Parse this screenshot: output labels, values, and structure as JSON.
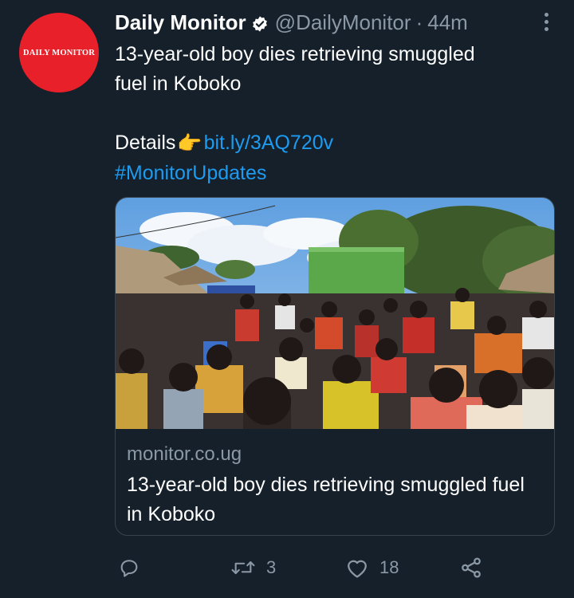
{
  "tweet": {
    "avatar_text": "DAILY MONITOR",
    "display_name": "Daily Monitor",
    "handle": "@DailyMonitor",
    "separator": "·",
    "time": "44m",
    "text_line1": "13-year-old boy dies retrieving smuggled",
    "text_line2": "fuel in Koboko",
    "details_label": "Details",
    "pointer_emoji": "👉",
    "link": "bit.ly/3AQ720v",
    "hashtag": "#MonitorUpdates"
  },
  "card": {
    "domain": "monitor.co.ug",
    "title": "13-year-old boy dies retrieving smuggled fuel in Koboko"
  },
  "actions": {
    "retweets": "3",
    "likes": "18"
  },
  "colors": {
    "background": "#15202b",
    "avatar_red": "#e8202a",
    "link_blue": "#1d9bf0",
    "muted": "#8b98a5",
    "border": "#38444d"
  },
  "icons": [
    "verified-badge-icon",
    "more-icon",
    "reply-icon",
    "retweet-icon",
    "like-icon",
    "share-icon"
  ]
}
